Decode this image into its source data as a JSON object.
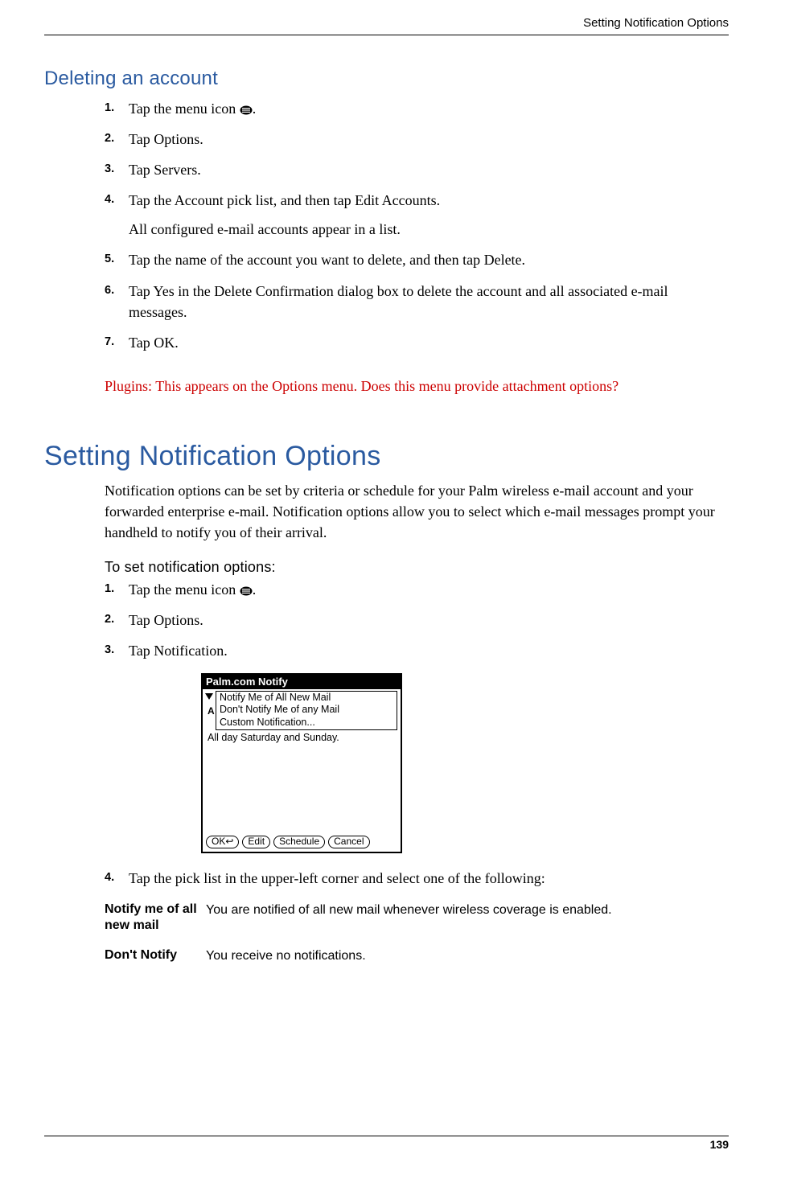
{
  "header": {
    "running_head": "Setting Notification Options"
  },
  "section1": {
    "heading": "Deleting an account",
    "steps": [
      {
        "num": "1.",
        "text_before": "Tap the menu icon ",
        "text_after": "."
      },
      {
        "num": "2.",
        "text": "Tap Options."
      },
      {
        "num": "3.",
        "text": "Tap Servers."
      },
      {
        "num": "4.",
        "text": "Tap the Account pick list, and then tap Edit Accounts.",
        "sub": "All configured e-mail accounts appear in a list."
      },
      {
        "num": "5.",
        "text": "Tap the name of the account you want to delete, and then tap Delete."
      },
      {
        "num": "6.",
        "text": "Tap Yes in the Delete Confirmation dialog box to delete the account and all associated e-mail messages."
      },
      {
        "num": "7.",
        "text": "Tap OK."
      }
    ],
    "plugins_note": "Plugins: This appears on the Options menu. Does this menu provide attachment options?"
  },
  "section2": {
    "heading": "Setting Notification Options",
    "intro": "Notification options can be set by criteria or schedule for your Palm wireless e-mail account and your forwarded enterprise e-mail. Notification options allow you to select which e-mail messages prompt your handheld to notify you of their arrival.",
    "subhead": "To set notification options:",
    "steps_a": [
      {
        "num": "1.",
        "text_before": "Tap the menu icon ",
        "text_after": "."
      },
      {
        "num": "2.",
        "text": "Tap Options."
      },
      {
        "num": "3.",
        "text": "Tap Notification."
      }
    ],
    "dialog": {
      "title": "Palm.com Notify",
      "picklist": [
        "Notify Me of All New Mail",
        "Don't Notify Me of any Mail",
        "Custom Notification..."
      ],
      "schedule_line": "All day Saturday and Sunday.",
      "buttons": {
        "ok": "OK",
        "ok_arrow": "↩",
        "edit": "Edit",
        "schedule": "Schedule",
        "cancel": "Cancel"
      }
    },
    "step4": {
      "num": "4.",
      "text": "Tap the pick list in the upper-left corner and select one of the following:"
    },
    "options": [
      {
        "term": "Notify me of all new mail",
        "def": "You are notified of all new mail whenever wireless coverage is enabled."
      },
      {
        "term": "Don't Notify",
        "def": "You receive no notifications."
      }
    ]
  },
  "footer": {
    "page_number": "139"
  }
}
